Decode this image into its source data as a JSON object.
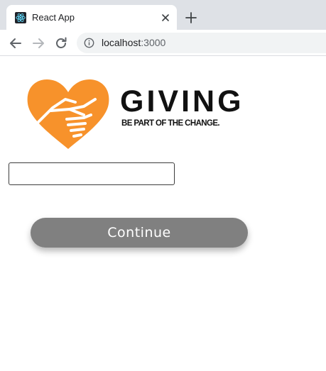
{
  "browser": {
    "tab": {
      "title": "React App",
      "favicon": "react-icon"
    },
    "new_tab_icon": "plus-icon",
    "nav": {
      "back_icon": "back-arrow-icon",
      "forward_icon": "forward-arrow-icon",
      "reload_icon": "reload-icon"
    },
    "address_bar": {
      "host": "localhost",
      "port": ":3000",
      "site_info_icon": "info-icon"
    }
  },
  "page": {
    "logo": {
      "wordmark": "GIVING",
      "tagline": "BE PART OF THE CHANGE.",
      "heart_color": "#f7922b",
      "text_color": "#111111"
    },
    "input": {
      "value": "",
      "placeholder": ""
    },
    "continue_button": {
      "label": "Continue",
      "background": "#808080",
      "text_color": "#ffffff"
    }
  }
}
